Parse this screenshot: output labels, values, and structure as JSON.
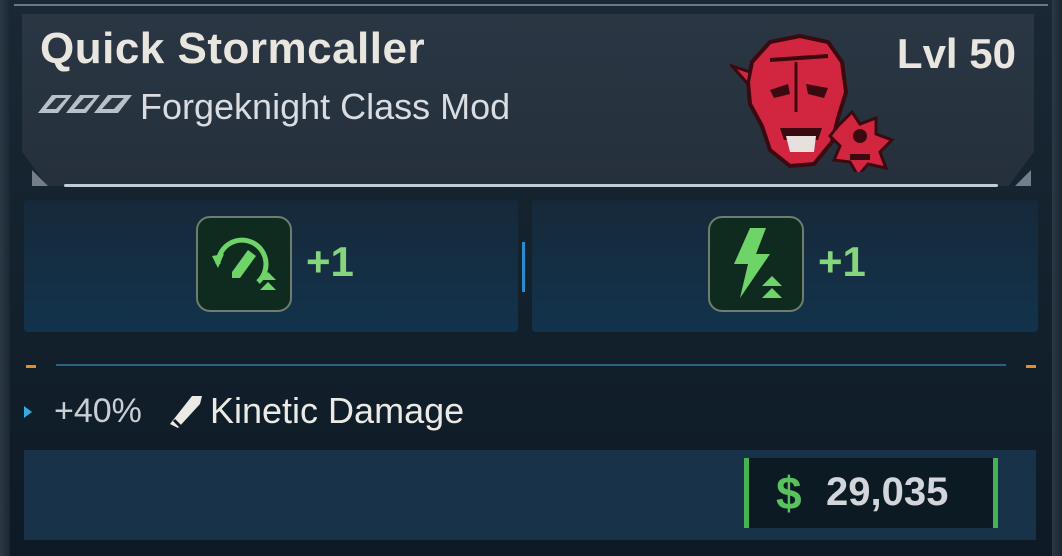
{
  "item": {
    "name": "Quick Stormcaller",
    "type": "Forgeknight Class Mod",
    "level": "Lvl 50",
    "rarity_icon": "rarity-chevrons-icon",
    "class_icon": "forgeknight-portrait-icon"
  },
  "skill_bonuses": [
    {
      "icon": "ammo-reload-upgrade-icon",
      "value": "+1"
    },
    {
      "icon": "lightning-upgrade-icon",
      "value": "+1"
    }
  ],
  "stat": {
    "value": "+40%",
    "icon": "kinetic-bullet-icon",
    "label": "Kinetic Damage"
  },
  "price": {
    "currency_symbol": "$",
    "value": "29,035"
  },
  "colors": {
    "accent_green": "#58c25d",
    "class_red": "#d2253f",
    "accent_blue": "#2a8ccc",
    "accent_orange": "#e98a2a"
  }
}
